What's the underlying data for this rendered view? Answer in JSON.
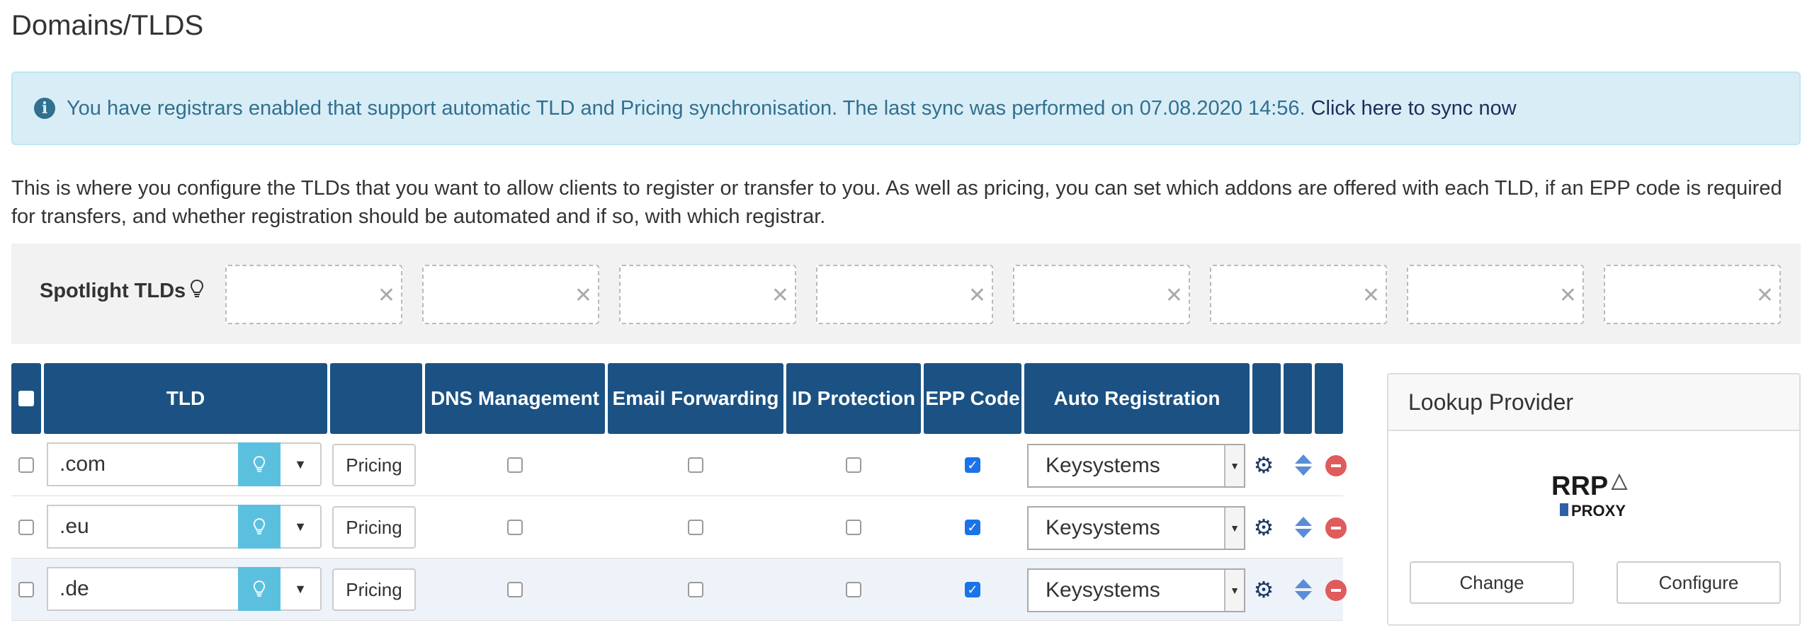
{
  "page": {
    "title": "Domains/TLDS"
  },
  "alert": {
    "icon": "info-circle-icon",
    "message": "You have registrars enabled that support automatic TLD and Pricing synchronisation. The last sync was performed on 07.08.2020 14:56.",
    "link_text": "Click here to sync now"
  },
  "description": "This is where you configure the TLDs that you want to allow clients to register or transfer to you. As well as pricing, you can set which addons are offered with each TLD, if an EPP code is required for transfers, and whether registration should be automated and if so, with which registrar.",
  "spotlight": {
    "label": "Spotlight TLDs",
    "icon": "lightbulb-icon",
    "slots": [
      "",
      "",
      "",
      "",
      "",
      "",
      "",
      ""
    ]
  },
  "table": {
    "headers": {
      "tld": "TLD",
      "pricing": "",
      "dns": "DNS Management",
      "email": "Email Forwarding",
      "idprot": "ID Protection",
      "epp": "EPP Code",
      "autoreg": "Auto Registration"
    },
    "rows": [
      {
        "tld": ".com",
        "pricing_label": "Pricing",
        "dns": false,
        "email": false,
        "idprot": false,
        "epp": true,
        "registrar": "Keysystems"
      },
      {
        "tld": ".eu",
        "pricing_label": "Pricing",
        "dns": false,
        "email": false,
        "idprot": false,
        "epp": true,
        "registrar": "Keysystems"
      },
      {
        "tld": ".de",
        "pricing_label": "Pricing",
        "dns": false,
        "email": false,
        "idprot": false,
        "epp": true,
        "registrar": "Keysystems"
      }
    ]
  },
  "lookup": {
    "title": "Lookup Provider",
    "logo_text": "RRP",
    "logo_subtext": "PROXY",
    "change_label": "Change",
    "configure_label": "Configure"
  },
  "colors": {
    "header_bg": "#1b5283",
    "alert_bg": "#d9edf7",
    "alert_text": "#31708f",
    "bulb_btn": "#5bc0de",
    "remove": "#e05b5b"
  }
}
